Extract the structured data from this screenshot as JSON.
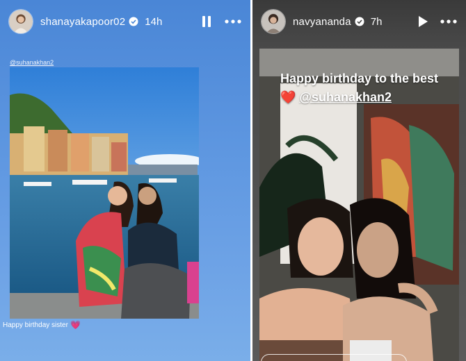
{
  "left_story": {
    "username": "shanayakapoor02",
    "time": "14h",
    "mention_sticker": "@suhanakhan2",
    "caption": "Happy birthday sister",
    "caption_emoji": "💗",
    "controls": {
      "pause_icon": "pause-icon",
      "more_icon": "more-icon"
    }
  },
  "right_story": {
    "username": "navyananda",
    "time": "7h",
    "caption_text": "Happy birthday to the best",
    "caption_emoji": "❤️",
    "caption_mention": "@suhanakhan2",
    "controls": {
      "play_icon": "play-icon",
      "more_icon": "more-icon"
    }
  },
  "colors": {
    "left_background": "#5d96e0",
    "right_background": "#4a4a4a",
    "verified_badge": "#ffffff",
    "heart_pink": "#e36bd9",
    "heart_red": "#e0222b"
  }
}
